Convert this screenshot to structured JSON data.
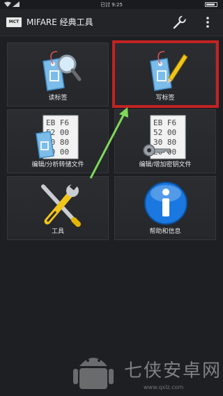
{
  "status_bar": {
    "time": "已讨 9:25"
  },
  "app_bar": {
    "logo_text": "MCT",
    "title": "MIFARE  经典工具"
  },
  "tiles": [
    {
      "label": "读标签"
    },
    {
      "label": "写标签"
    },
    {
      "label": "编辑/分析转储文件"
    },
    {
      "label": "编辑/增加密钥文件"
    },
    {
      "label": "工具"
    },
    {
      "label": "帮助和信息"
    }
  ],
  "hex_preview": [
    [
      "EB F6",
      "52 00",
      "30 80",
      "E0 00"
    ],
    [
      "EB F6",
      "52 00",
      "30 80",
      "E0 00"
    ]
  ],
  "watermark": {
    "brand": "七侠安卓网",
    "url": "www.qxlz.com"
  },
  "colors": {
    "highlight": "#c42222",
    "arrow": "#7ed957",
    "tag_blue": "#6fb3e6",
    "info_blue": "#1a78e0"
  }
}
